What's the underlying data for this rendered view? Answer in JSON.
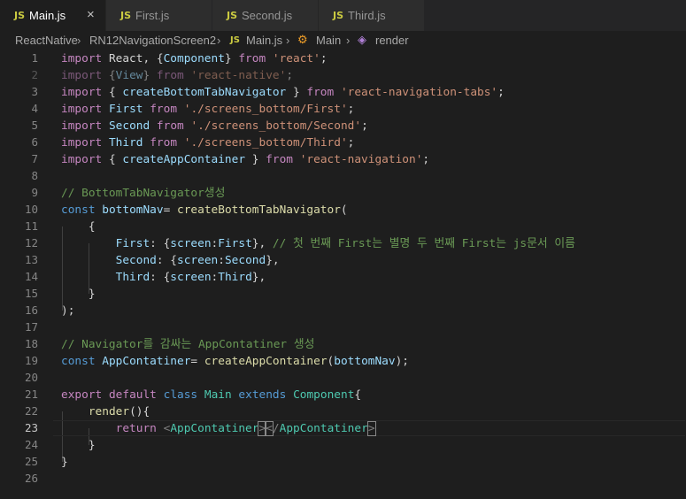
{
  "tabs": [
    {
      "label": "Main.js",
      "icon": "JS",
      "active": true,
      "close": "×"
    },
    {
      "label": "First.js",
      "icon": "JS",
      "active": false
    },
    {
      "label": "Second.js",
      "icon": "JS",
      "active": false
    },
    {
      "label": "Third.js",
      "icon": "JS",
      "active": false
    }
  ],
  "breadcrumb": {
    "folder1": "ReactNative",
    "folder2": "RN12NavigationScreen2",
    "file_icon": "JS",
    "file": "Main.js",
    "class": "Main",
    "method": "render"
  },
  "line_numbers": [
    "1",
    "2",
    "3",
    "4",
    "5",
    "6",
    "7",
    "8",
    "9",
    "10",
    "11",
    "12",
    "13",
    "14",
    "15",
    "16",
    "17",
    "18",
    "19",
    "20",
    "21",
    "22",
    "23",
    "24",
    "25",
    "26"
  ],
  "code": {
    "l1": [
      "import",
      " React, {",
      "Component",
      "} ",
      "from",
      " ",
      "'react'",
      ";"
    ],
    "l2": [
      "import",
      " {",
      "View",
      "} ",
      "from",
      " ",
      "'react-native'",
      ";"
    ],
    "l3": [
      "import",
      " { ",
      "createBottomTabNavigator",
      " } ",
      "from",
      " ",
      "'react-navigation-tabs'",
      ";"
    ],
    "l4": [
      "import",
      " ",
      "First",
      " ",
      "from",
      " ",
      "'./screens_bottom/First'",
      ";"
    ],
    "l5": [
      "import",
      " ",
      "Second",
      " ",
      "from",
      " ",
      "'./screens_bottom/Second'",
      ";"
    ],
    "l6": [
      "import",
      " ",
      "Third",
      " ",
      "from",
      " ",
      "'./screens_bottom/Third'",
      ";"
    ],
    "l7": [
      "import",
      " { ",
      "createAppContainer",
      " } ",
      "from",
      " ",
      "'react-navigation'",
      ";"
    ],
    "l9": "// BottomTabNavigator생성",
    "l10": [
      "const",
      " ",
      "bottomNav",
      "= ",
      "createBottomTabNavigator",
      "("
    ],
    "l11": "{",
    "l12": [
      "First",
      ": {",
      "screen",
      ":",
      "First",
      "}, ",
      "// 첫 번째 First는 별명 두 번째 First는 js문서 이름"
    ],
    "l13": [
      "Second",
      ": {",
      "screen",
      ":",
      "Second",
      "},"
    ],
    "l14": [
      "Third",
      ": {",
      "screen",
      ":",
      "Third",
      "},"
    ],
    "l15": "}",
    "l16": ");",
    "l18": "// Navigator를 감싸는 AppContatiner 생성",
    "l19": [
      "const",
      " ",
      "AppContatiner",
      "= ",
      "createAppContainer",
      "(",
      "bottomNav",
      ");"
    ],
    "l21": [
      "export",
      " ",
      "default",
      " ",
      "class",
      " ",
      "Main",
      " ",
      "extends",
      " ",
      "Component",
      "{"
    ],
    "l22": [
      "render",
      "(){"
    ],
    "l23": [
      "return",
      " ",
      "<",
      "AppContatiner",
      ">",
      "<",
      "/",
      "AppContatiner",
      ">"
    ],
    "l24": "}",
    "l25": "}"
  }
}
